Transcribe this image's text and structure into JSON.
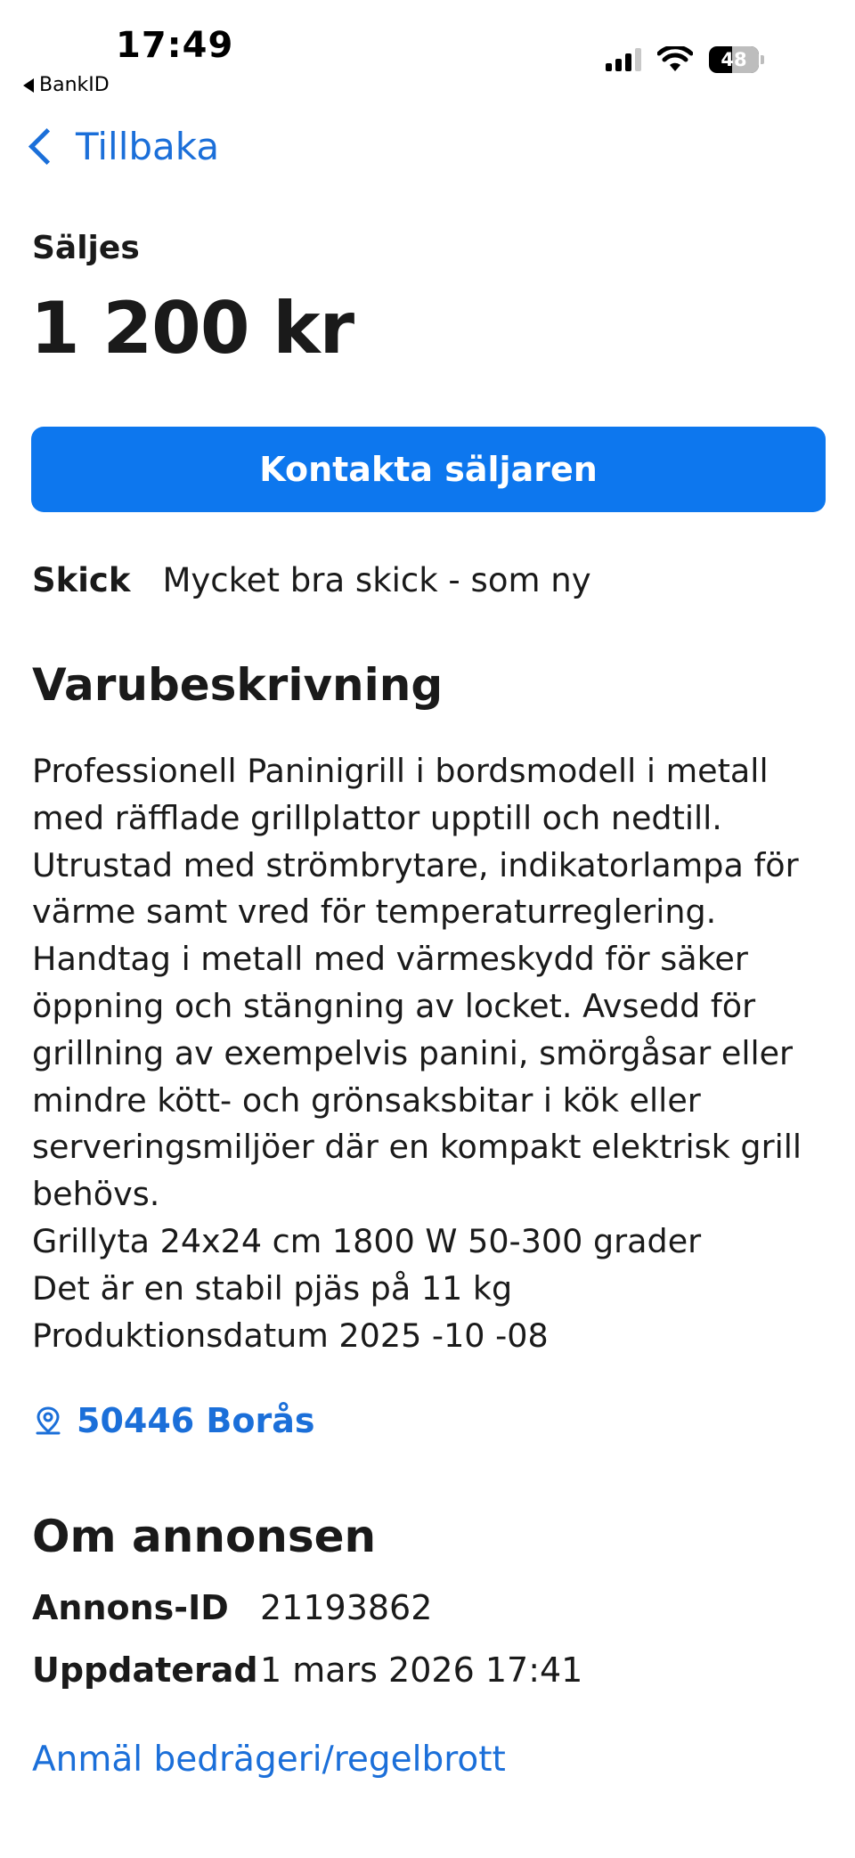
{
  "status_bar": {
    "time": "17:49",
    "back_app": "BankID",
    "battery": "48"
  },
  "nav": {
    "back_label": "Tillbaka"
  },
  "listing": {
    "type_label": "Säljes",
    "price": "1 200 kr",
    "contact_button": "Kontakta säljaren",
    "condition_key": "Skick",
    "condition_value": "Mycket bra skick - som ny",
    "description_title": "Varubeskrivning",
    "description_lines": [
      "Professionell Paninigrill i bordsmodell i metall",
      "med räfflade grillplattor upptill och nedtill.",
      "Utrustad med strömbrytare, indikatorlampa för",
      "värme samt vred för temperaturreglering.",
      "Handtag i metall med värmeskydd för säker",
      "öppning och stängning av locket. Avsedd för",
      "grillning av exempelvis panini, smörgåsar eller",
      "mindre kött- och grönsaksbitar i kök eller",
      "serveringsmiljöer där en kompakt elektrisk grill",
      "behövs.",
      "Grillyta 24x24 cm 1800 W 50-300 grader",
      "Det är en stabil pjäs på 11 kg",
      "Produktionsdatum 2025 -10 -08"
    ],
    "location": "50446 Borås"
  },
  "about": {
    "title": "Om annonsen",
    "ad_id_key": "Annons-ID",
    "ad_id_value": "21193862",
    "updated_key": "Uppdaterad",
    "updated_value": "1 mars 2026 17:41",
    "report_link": "Anmäl bedrägeri/regelbrott"
  },
  "colors": {
    "accent": "#0d77ee",
    "link": "#1b6fd9",
    "text": "#1a1a1a"
  }
}
